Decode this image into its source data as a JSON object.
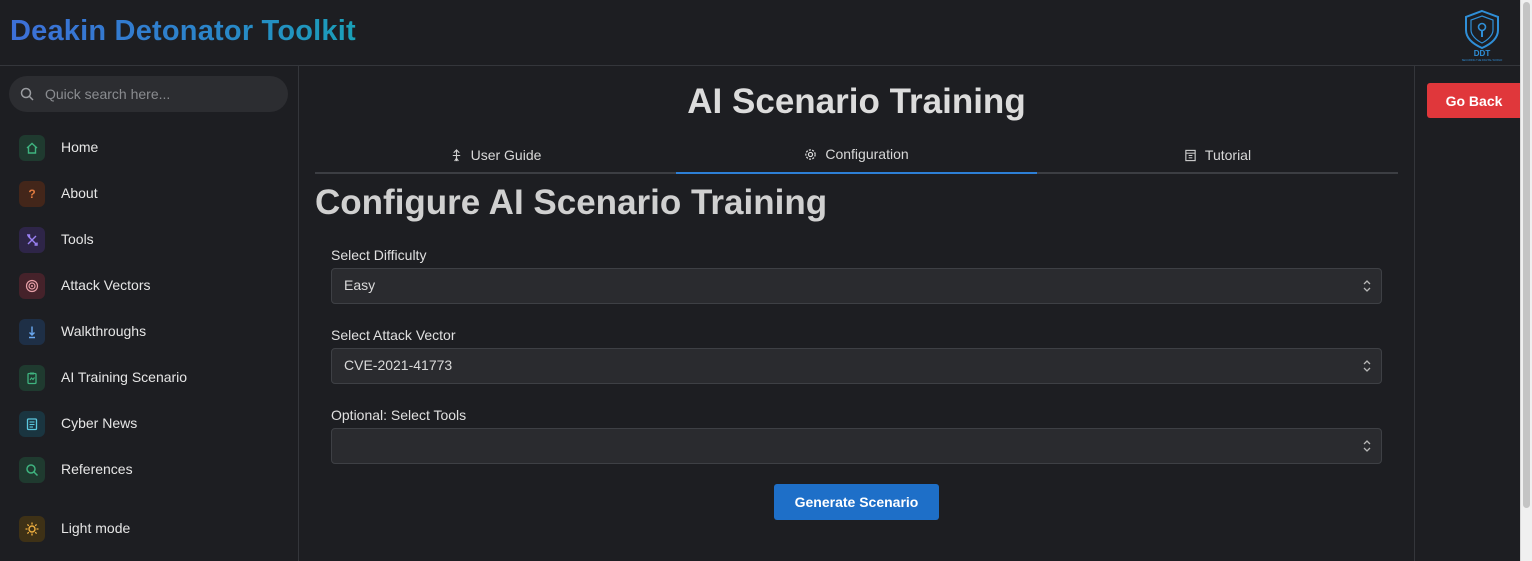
{
  "app": {
    "title": "Deakin Detonator Toolkit",
    "logo_text": "DDT",
    "logo_tagline": "SECURING THE DIGITAL WORLD"
  },
  "search": {
    "placeholder": "Quick search here..."
  },
  "sidebar": {
    "items": [
      {
        "label": "Home",
        "icon": "home-icon",
        "color": "#3fb37f"
      },
      {
        "label": "About",
        "icon": "question-icon",
        "color": "#e07a3f"
      },
      {
        "label": "Tools",
        "icon": "tools-icon",
        "color": "#8b6cf0"
      },
      {
        "label": "Attack Vectors",
        "icon": "target-icon",
        "color": "#e05a5a"
      },
      {
        "label": "Walkthroughs",
        "icon": "pointer-icon",
        "color": "#4a90e2"
      },
      {
        "label": "AI Training Scenario",
        "icon": "clipboard-icon",
        "color": "#3fb37f"
      },
      {
        "label": "Cyber News",
        "icon": "news-icon",
        "color": "#2bb0c8"
      },
      {
        "label": "References",
        "icon": "search-icon",
        "color": "#3fb37f"
      }
    ],
    "theme_toggle": {
      "label": "Light mode",
      "icon": "sun-icon",
      "color": "#f0b040"
    }
  },
  "main": {
    "title": "AI Scenario Training",
    "tabs": [
      {
        "label": "User Guide",
        "icon": "guide-icon",
        "active": false
      },
      {
        "label": "Configuration",
        "icon": "settings-icon",
        "active": true
      },
      {
        "label": "Tutorial",
        "icon": "tutorial-icon",
        "active": false
      }
    ],
    "section_title": "Configure AI Scenario Training",
    "form": {
      "difficulty": {
        "label": "Select Difficulty",
        "value": "Easy"
      },
      "attack_vector": {
        "label": "Select Attack Vector",
        "value": "CVE-2021-41773"
      },
      "tools": {
        "label": "Optional: Select Tools",
        "value": ""
      },
      "submit_label": "Generate Scenario"
    }
  },
  "right_panel": {
    "go_back_label": "Go Back"
  },
  "colors": {
    "background": "#1d1e22",
    "accent_blue": "#1e6fc8",
    "danger_red": "#e0373b"
  }
}
